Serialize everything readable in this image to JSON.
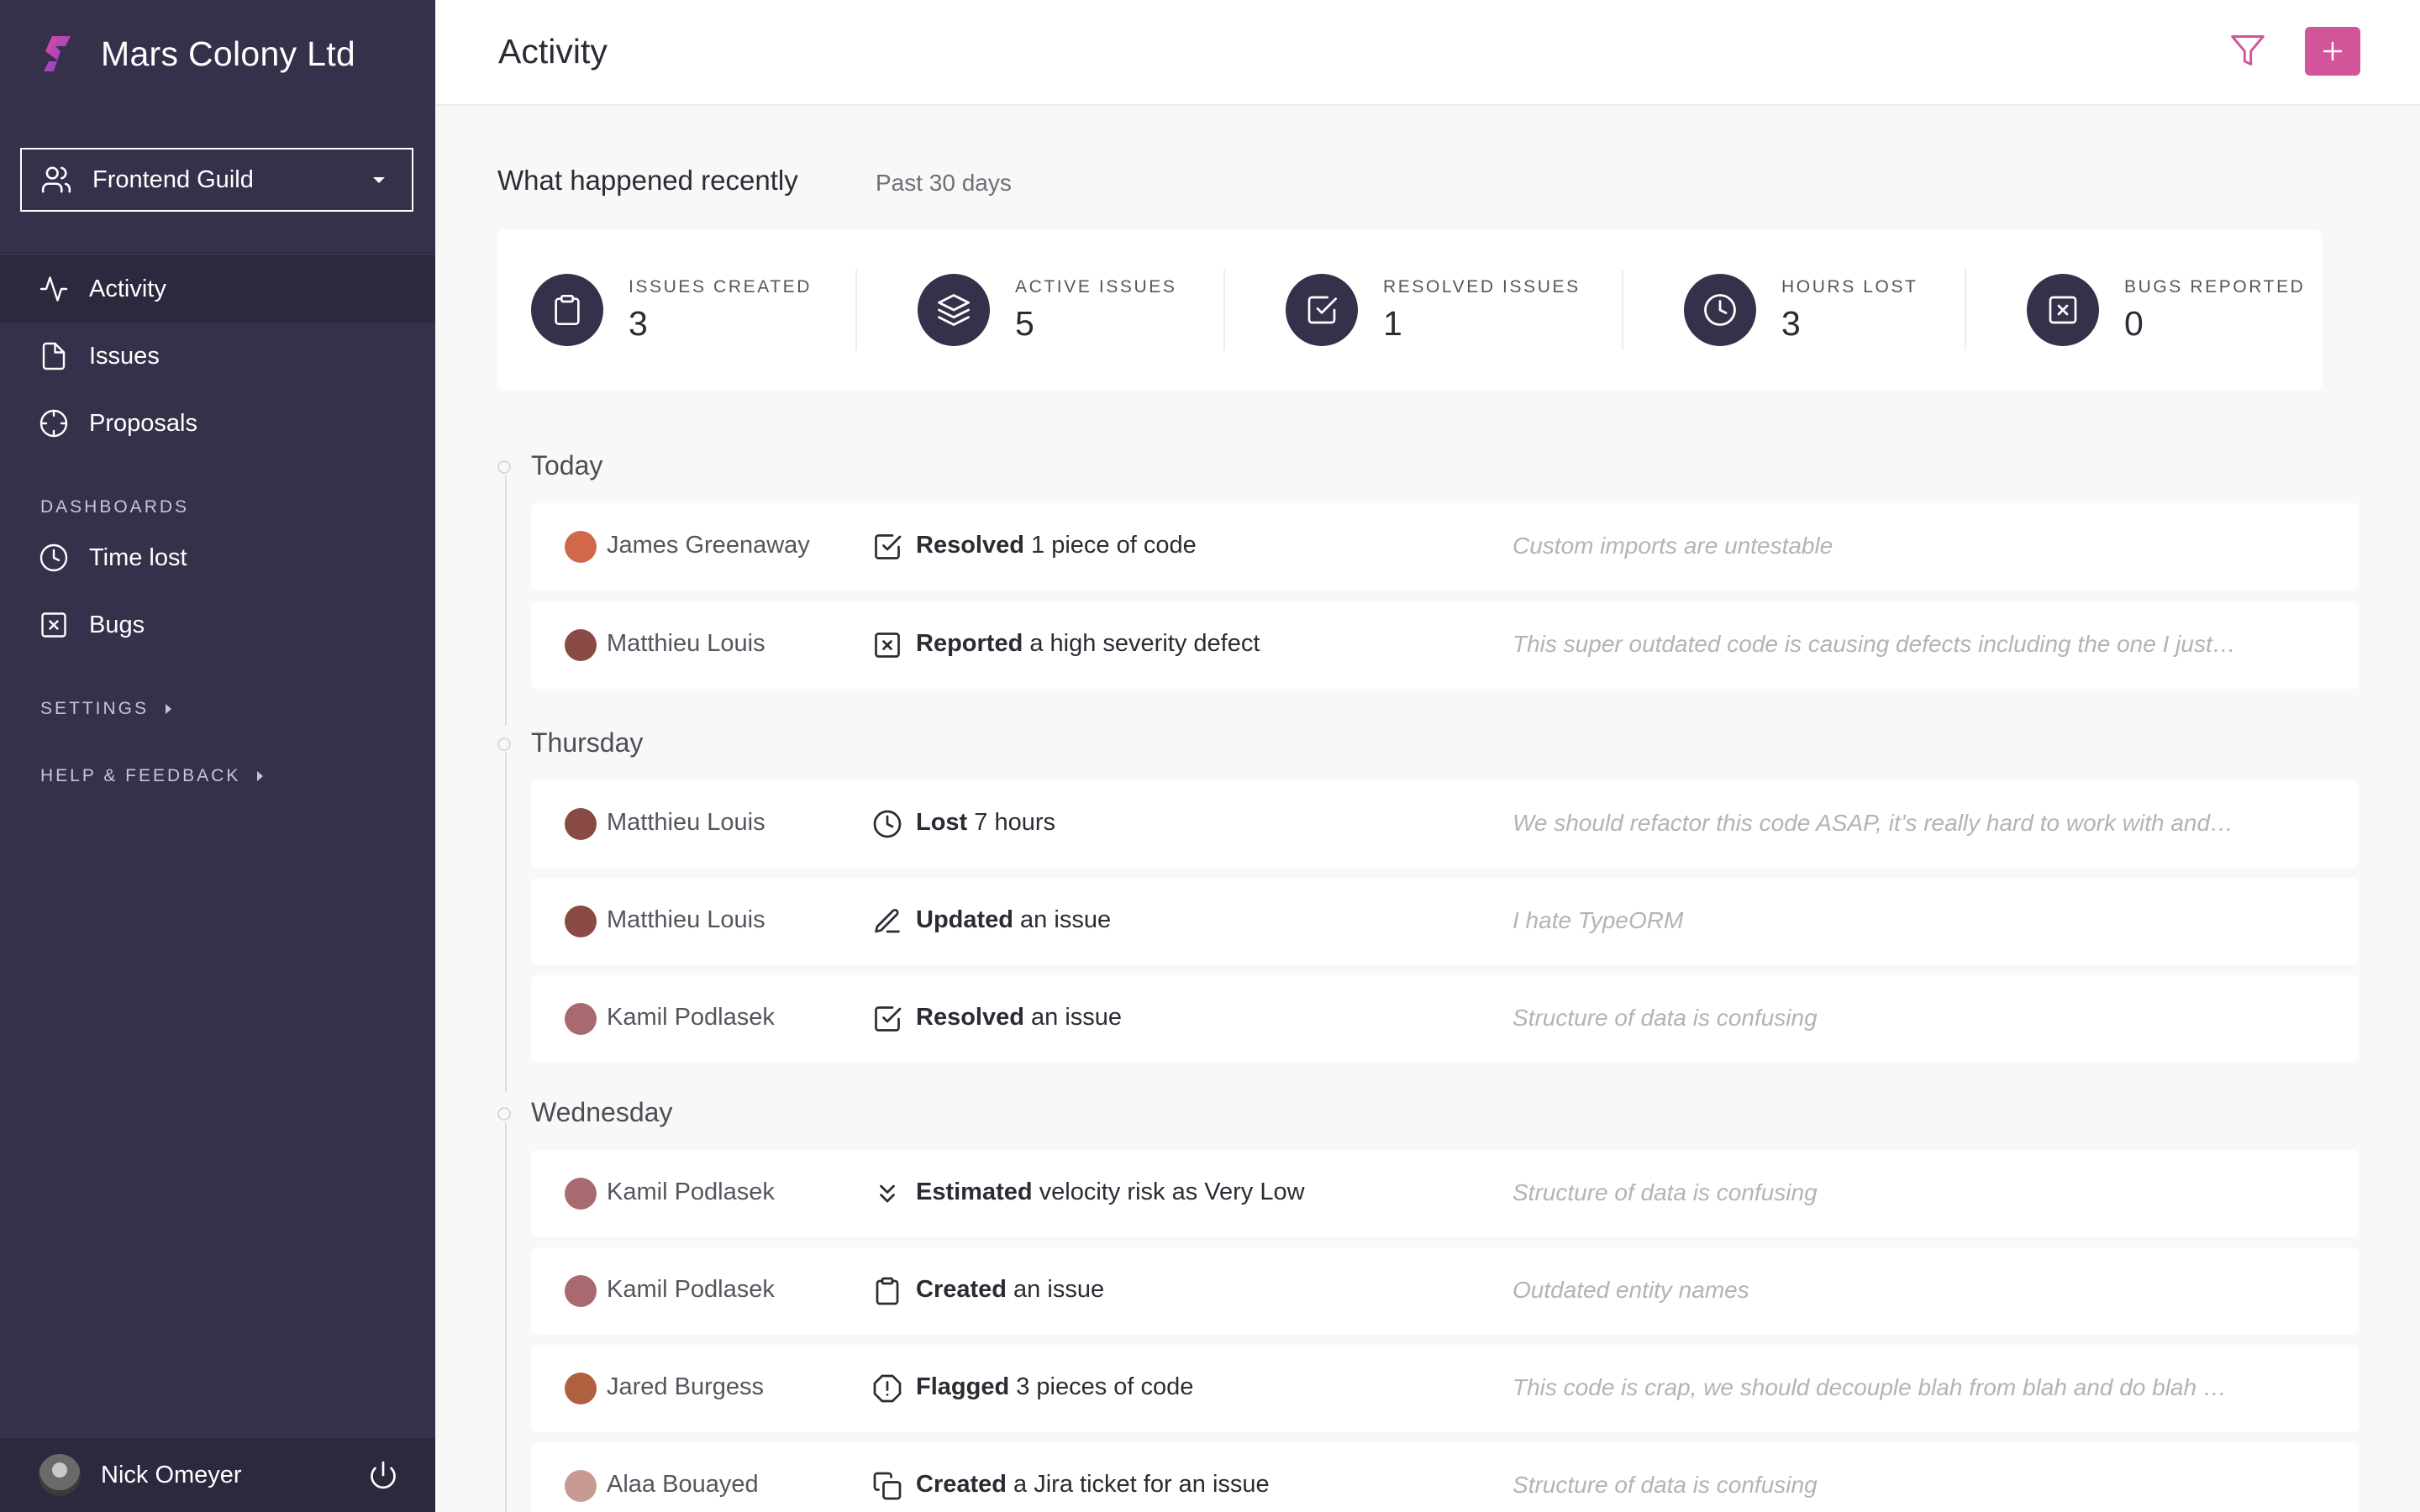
{
  "org": {
    "name": "Mars Colony Ltd"
  },
  "team_select": {
    "value": "Frontend Guild"
  },
  "nav": {
    "activity": "Activity",
    "issues": "Issues",
    "proposals": "Proposals",
    "dashboards_label": "DASHBOARDS",
    "time_lost": "Time lost",
    "bugs": "Bugs",
    "settings_label": "SETTINGS",
    "help_label": "HELP & FEEDBACK"
  },
  "user": {
    "name": "Nick Omeyer"
  },
  "header": {
    "title": "Activity"
  },
  "summary": {
    "title": "What happened recently",
    "period": "Past 30 days",
    "stats": [
      {
        "label": "ISSUES CREATED",
        "value": "3",
        "icon": "clipboard-icon"
      },
      {
        "label": "ACTIVE ISSUES",
        "value": "5",
        "icon": "layers-icon"
      },
      {
        "label": "RESOLVED ISSUES",
        "value": "1",
        "icon": "check-square-icon"
      },
      {
        "label": "HOURS LOST",
        "value": "3",
        "icon": "clock-icon"
      },
      {
        "label": "BUGS REPORTED",
        "value": "0",
        "icon": "x-square-icon"
      }
    ]
  },
  "days": [
    {
      "label": "Today"
    },
    {
      "label": "Thursday"
    },
    {
      "label": "Wednesday"
    }
  ],
  "activities": [
    {
      "user": "James Greenaway",
      "verb": "Resolved",
      "rest": " 1 piece of code",
      "note": "Custom imports are untestable",
      "icon": "check-square-icon",
      "avatar": "#d2684a"
    },
    {
      "user": "Matthieu Louis",
      "verb": "Reported",
      "rest": " a high severity defect",
      "note": "This super outdated code is causing defects including the one I just…",
      "icon": "x-square-icon",
      "avatar": "#8a4a44"
    },
    {
      "user": "Matthieu Louis",
      "verb": "Lost",
      "rest": " 7 hours",
      "note": "We should refactor this code ASAP, it’s really hard to work with and…",
      "icon": "clock-icon",
      "avatar": "#8a4a44"
    },
    {
      "user": "Matthieu Louis",
      "verb": "Updated",
      "rest": " an issue",
      "note": "I hate TypeORM",
      "icon": "pencil-icon",
      "avatar": "#8a4a44"
    },
    {
      "user": "Kamil Podlasek",
      "verb": "Resolved",
      "rest": " an issue",
      "note": "Structure of data is confusing",
      "icon": "check-square-icon",
      "avatar": "#a86a6e"
    },
    {
      "user": "Kamil Podlasek",
      "verb": "Estimated",
      "rest": " velocity risk as Very Low",
      "note": "Structure of data is confusing",
      "icon": "chevrons-down-icon",
      "avatar": "#a86a6e"
    },
    {
      "user": "Kamil Podlasek",
      "verb": "Created",
      "rest": " an issue",
      "note": "Outdated entity names",
      "icon": "clipboard-icon",
      "avatar": "#a86a6e"
    },
    {
      "user": "Jared Burgess",
      "verb": "Flagged",
      "rest": " 3 pieces of code",
      "note": "This code is crap, we should decouple blah from blah and do blah …",
      "icon": "alert-octagon-icon",
      "avatar": "#b0603e"
    },
    {
      "user": "Alaa Bouayed",
      "verb": "Created",
      "rest": " a Jira ticket for an issue",
      "note": "Structure of data is confusing",
      "icon": "copy-icon",
      "avatar": "#c79a94"
    }
  ],
  "colors": {
    "sidebar": "#36304a",
    "accent": "#d2559a",
    "background": "#f8f8f8"
  }
}
